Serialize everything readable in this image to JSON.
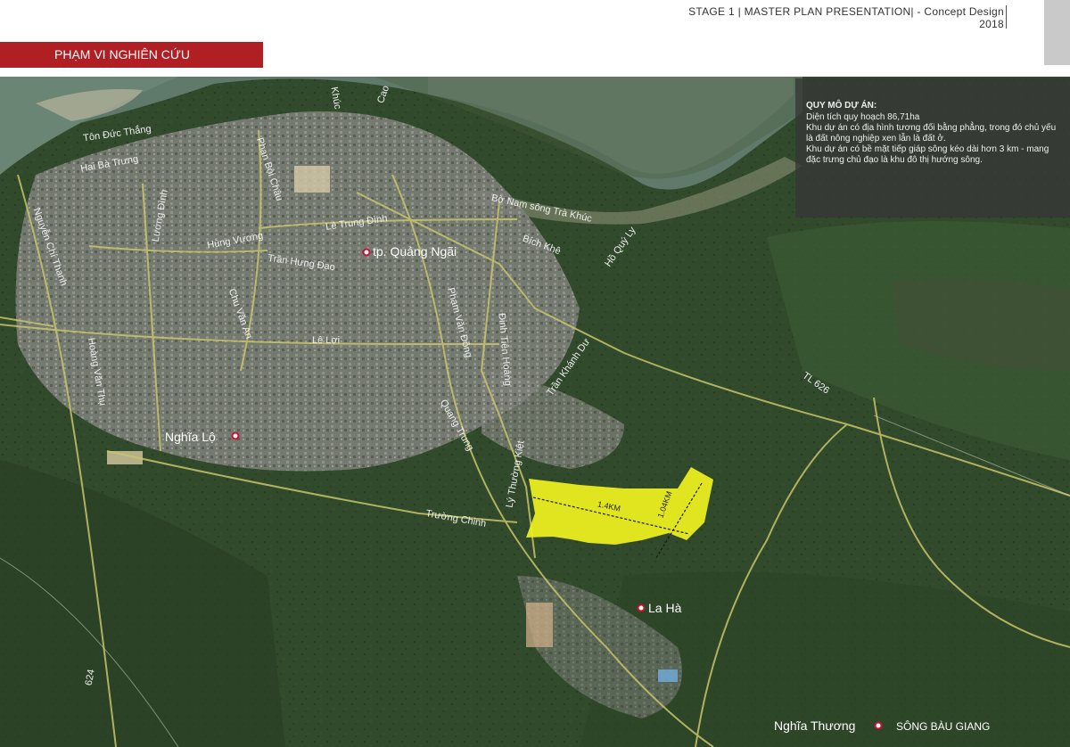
{
  "header": {
    "title_line1": "STAGE 1 | MASTER PLAN  PRESENTATION| - Concept Design",
    "title_line2": "2018"
  },
  "section": {
    "label": "PHẠM VI NGHIÊN CỨU"
  },
  "info": {
    "title": "QUY MÔ DỰ ÁN:",
    "lines": [
      "Diện tích quy hoạch  86,71ha",
      "Khu dự án có địa hình tương đối bằng phẳng, trong đó chủ yếu là đất nông nghiệp xen lẫn là đất ở.",
      "Khu dự án có bề mặt tiếp giáp sông kéo dài hơn 3 km - mang đặc trưng chủ đạo là khu đô thị hướng sông."
    ]
  },
  "map": {
    "places": {
      "quang_ngai": "tp. Quảng Ngãi",
      "nghia_lo": "Nghĩa Lộ",
      "la_ha": "La Hà",
      "nghia_thuong": "Nghĩa Thương",
      "song_bau_giang": "SÔNG BÀU GIANG"
    },
    "streets": {
      "ton_duc_thang": "Tôn Đức Thắng",
      "hai_ba_trung": "Hai Bà Trưng",
      "nguyen_chi_thanh": "Nguyễn Chí Thanh",
      "luong_dinh": "Lương Đình",
      "phan_boi_chau": "Phan Bội Châu",
      "le_trung_dinh": "Lê Trung Đình",
      "hung_vuong": "Hùng Vương",
      "tran_hung_dao": "Trần Hưng Đạo",
      "chu_van_an": "Chu Văn An",
      "le_loi": "Lê Lợi",
      "hoang_van_thu": "Hoàng Văn Thụ",
      "phan_van_dong": "Phạm Văn Đồng",
      "quang_trung": "Quang Trung",
      "dinh_tien_hoang": "Đinh Tiên Hoàng",
      "tran_khanh_du": "Trần Khánh Dư",
      "bich_khe": "Bích Khê",
      "ho_quy_ly": "Hồ Quý Ly",
      "bo_nam": "Bờ Nam sông Trà Khúc",
      "truong_chinh": "Trường Chinh",
      "ly_thuong_kiet": "Lý Thường Kiệt",
      "khuc": "Khúc",
      "cao": "Cao",
      "tl626": "TL 626",
      "r624": "624"
    },
    "measures": {
      "length": "1.4KM",
      "width": "1.04KM"
    },
    "colors": {
      "site": "#f0f21e",
      "marker": "#c8102e",
      "road": "#c8c46a",
      "water": "#5f7a6a"
    }
  }
}
